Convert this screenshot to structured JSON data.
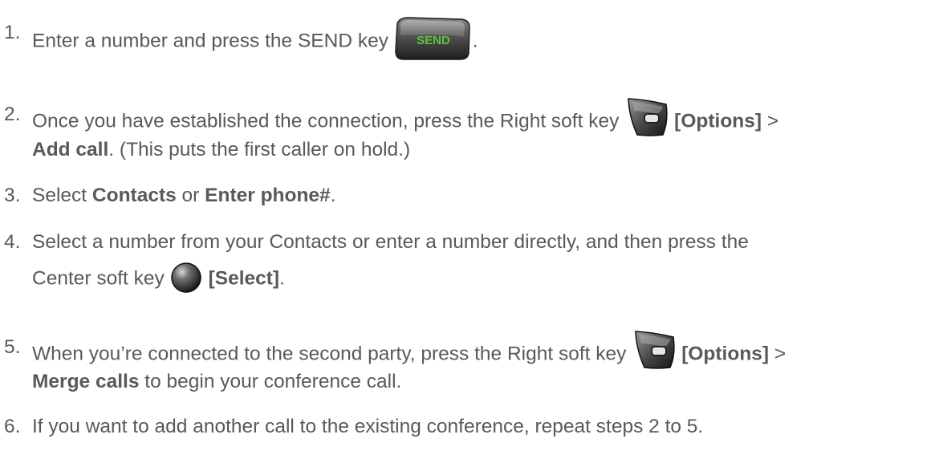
{
  "steps": [
    {
      "num": "1.",
      "line1": {
        "before": "Enter a number and press the SEND key ",
        "after": "."
      }
    },
    {
      "num": "2.",
      "line1": {
        "before": "Once you have established the connection, press the Right soft key ",
        "bold": "[Options]",
        "after": " >"
      },
      "line2": {
        "bold": "Add call",
        "after": ". (This puts the first caller on hold.)"
      }
    },
    {
      "num": "3.",
      "line1": {
        "a": "Select ",
        "b1": "Contacts",
        "c": " or ",
        "b2": "Enter phone#",
        "d": "."
      }
    },
    {
      "num": "4.",
      "line1": {
        "text": "Select a number from your Contacts or enter a number directly, and then press the"
      },
      "line2": {
        "before": "Center soft key ",
        "bold": "[Select]",
        "after": "."
      }
    },
    {
      "num": "5.",
      "line1": {
        "before": "When you’re connected to the second party, press the Right soft key ",
        "bold": "[Options]",
        "after": " >"
      },
      "line2": {
        "bold": "Merge calls",
        "after": " to begin your conference call."
      }
    },
    {
      "num": "6.",
      "line1": {
        "text": "If you want to add another call to the existing conference, repeat steps 2 to 5."
      }
    }
  ],
  "icons": {
    "send_key": {
      "name": "send-key-icon",
      "label": "SEND",
      "color": "#5cc23a"
    },
    "right_soft_key": {
      "name": "right-soft-key-icon"
    },
    "center_soft_key": {
      "name": "center-soft-key-icon"
    }
  }
}
